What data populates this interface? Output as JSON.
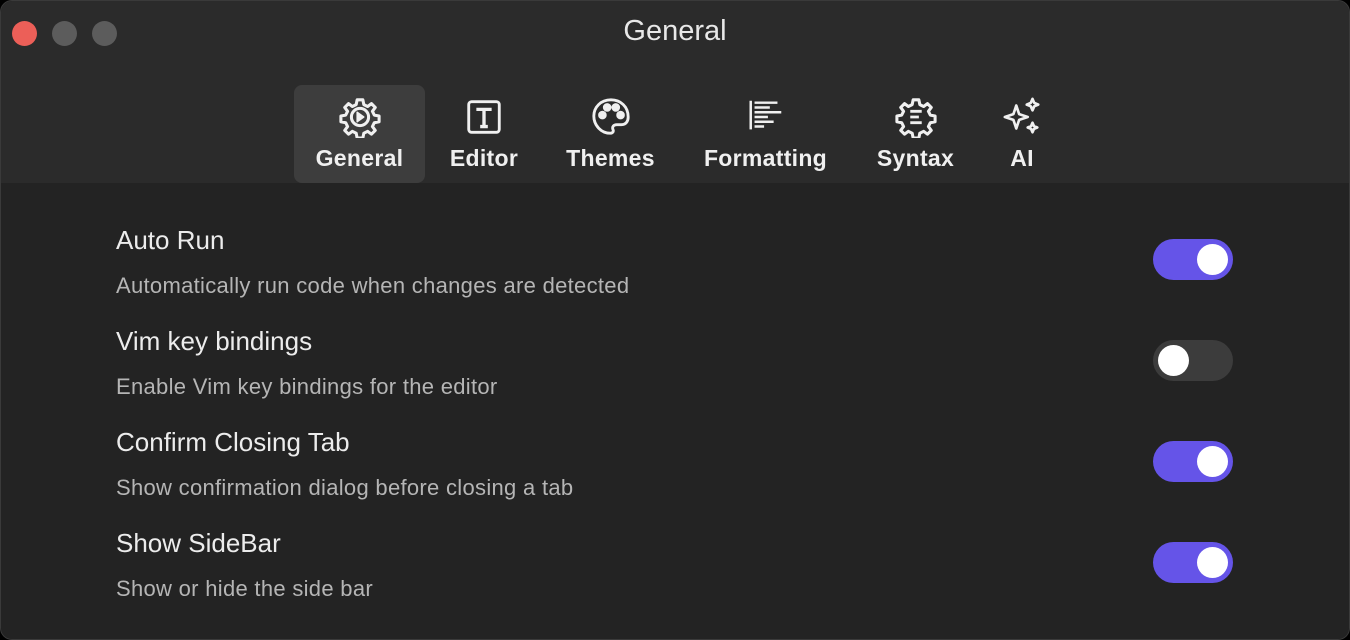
{
  "window": {
    "title": "General"
  },
  "tabs": [
    {
      "label": "General",
      "icon": "gear-play-icon",
      "active": true
    },
    {
      "label": "Editor",
      "icon": "text-box-icon",
      "active": false
    },
    {
      "label": "Themes",
      "icon": "palette-icon",
      "active": false
    },
    {
      "label": "Formatting",
      "icon": "lines-align-icon",
      "active": false
    },
    {
      "label": "Syntax",
      "icon": "gear-lines-icon",
      "active": false
    },
    {
      "label": "AI",
      "icon": "sparkles-icon",
      "active": false
    }
  ],
  "settings": [
    {
      "name": "Auto Run",
      "description": "Automatically run code when changes are detected",
      "enabled": true
    },
    {
      "name": "Vim key bindings",
      "description": "Enable Vim key bindings for the editor",
      "enabled": false
    },
    {
      "name": "Confirm Closing Tab",
      "description": "Show confirmation dialog before closing a tab",
      "enabled": true
    },
    {
      "name": "Show SideBar",
      "description": "Show or hide the side bar",
      "enabled": true
    }
  ],
  "colors": {
    "accent": "#6554e8",
    "toggle_off": "#3c3c3c",
    "close": "#ec5f58"
  }
}
